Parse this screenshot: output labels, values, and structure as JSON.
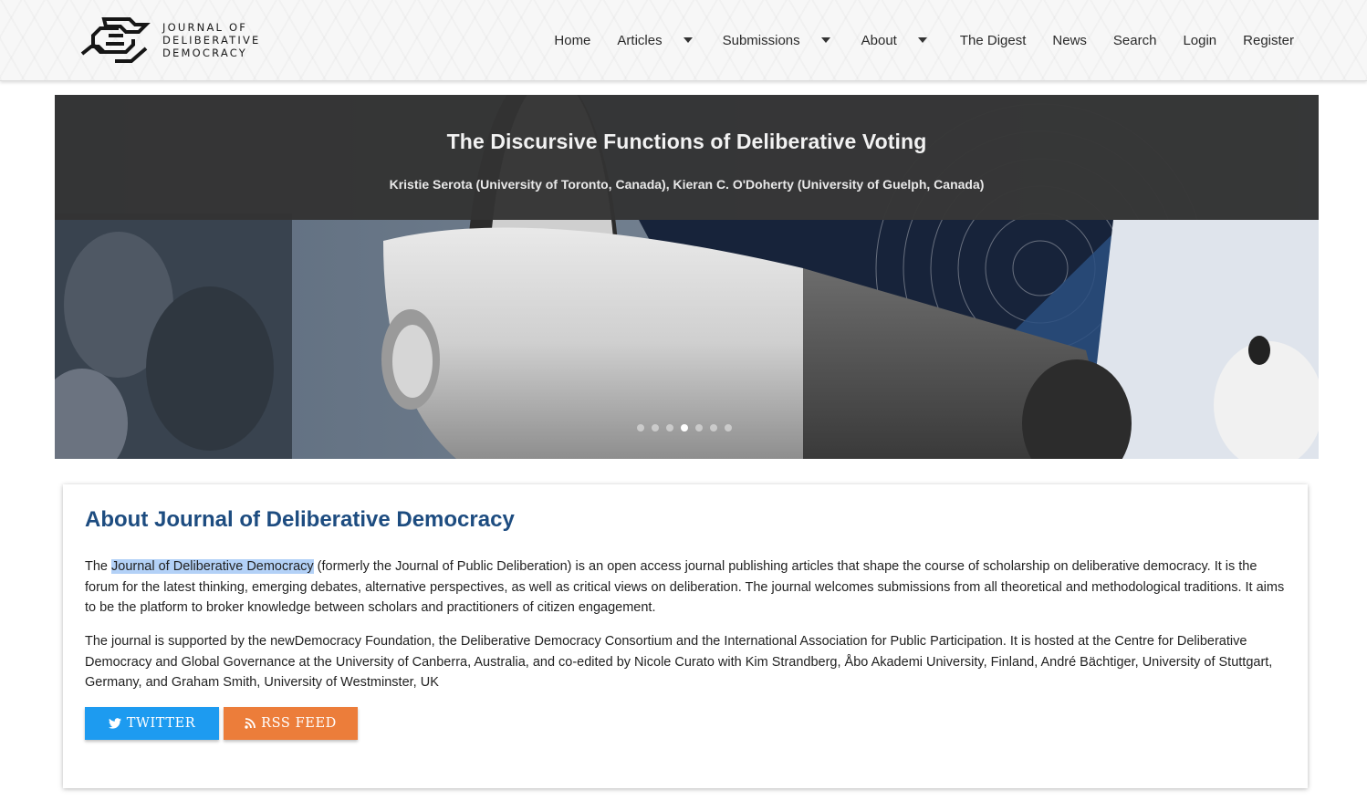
{
  "site": {
    "logo_lines": [
      "JOURNAL OF",
      "DELIBERATIVE",
      "DEMOCRACY"
    ]
  },
  "nav": {
    "home": "Home",
    "articles": "Articles",
    "submissions": "Submissions",
    "about": "About",
    "digest": "The Digest",
    "news": "News",
    "search": "Search",
    "login": "Login",
    "register": "Register"
  },
  "slider": {
    "title": "The Discursive Functions of Deliberative Voting",
    "authors": "Kristie Serota (University of Toronto, Canada), Kieran C. O'Doherty (University of Guelph, Canada)",
    "slide_count": 7,
    "active_slide": 4
  },
  "about": {
    "heading": "About Journal of Deliberative Democracy",
    "p1_prefix": "The ",
    "p1_highlight": "Journal of Deliberative Democracy",
    "p1_rest": " (formerly the Journal of Public Deliberation) is an open access journal publishing articles that shape the course of scholarship on deliberative democracy. It is the forum for the latest thinking, emerging debates, alternative perspectives, as well as critical views on deliberation. The journal welcomes submissions from all theoretical and methodological traditions. It aims to be the platform to broker knowledge between scholars and practitioners of citizen engagement.",
    "p2": "The journal is supported by the newDemocracy Foundation, the Deliberative Democracy Consortium and the International Association for Public Participation. It is hosted at the Centre for Deliberative Democracy and Global Governance at the University of Canberra, Australia, and co-edited by Nicole Curato with Kim Strandberg, Åbo Akademi University, Finland, André Bächtiger, University of Stuttgart, Germany, and Graham Smith, University of Westminster, UK",
    "twitter_label": "TWITTER",
    "rss_label": "RSS FEED"
  },
  "colors": {
    "heading": "#1d4c80",
    "twitter": "#1d9bf0",
    "rss": "#ec7d3a",
    "highlight": "#b3d1f7"
  },
  "icons": [
    "logo-mark-icon",
    "caret-down-icon",
    "twitter-bird-icon",
    "rss-icon"
  ]
}
